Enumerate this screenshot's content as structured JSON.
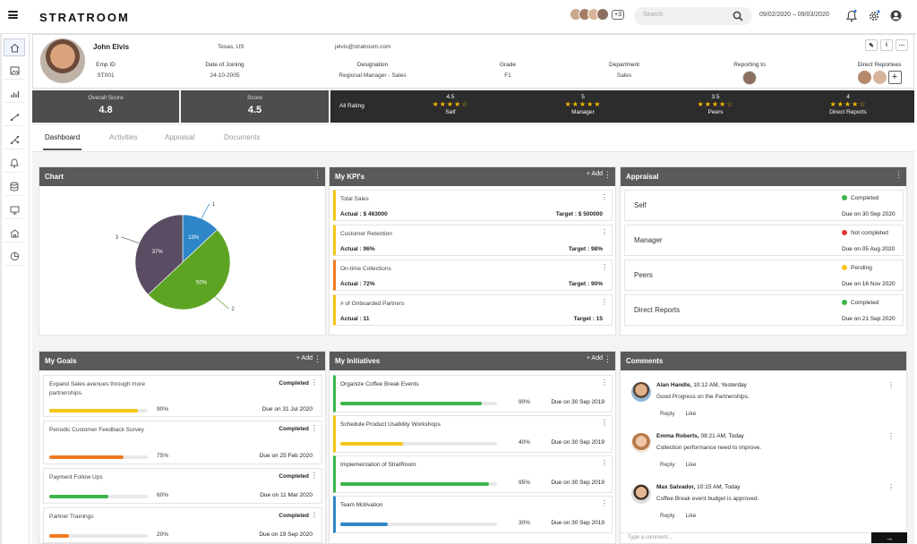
{
  "app": {
    "logo": "STRATROOM"
  },
  "header": {
    "participants_more": "+3",
    "search_placeholder": "Search",
    "date_range": "09/02/2020 – 09/03/2020"
  },
  "sidebar": {
    "icons": [
      "home-icon",
      "image-icon",
      "bar-chart-icon",
      "line-icon",
      "share-icon",
      "bell-icon",
      "database-icon",
      "monitor-icon",
      "building-icon",
      "pie-icon"
    ]
  },
  "profile": {
    "name": "John Elvis",
    "location": "Texas, US",
    "email": "jelvis@stratroom.com",
    "fields": [
      {
        "label": "Emp ID",
        "value": "ST001"
      },
      {
        "label": "Date of Joining",
        "value": "24-10-2005"
      },
      {
        "label": "Designation",
        "value": "Regional Manager - Sales"
      },
      {
        "label": "Grade",
        "value": "F1"
      },
      {
        "label": "Department",
        "value": "Sales"
      }
    ],
    "reporting_to_label": "Reporting to",
    "direct_reportees_label": "Direct Reportees"
  },
  "scores": {
    "overall_label": "Overall Score",
    "overall_value": "4.8",
    "score_label": "Score",
    "score_value": "4.5",
    "rating_label": "All Rating",
    "ratings": [
      {
        "value": "4.5",
        "stars": "★★★★☆",
        "name": "Self"
      },
      {
        "value": "5",
        "stars": "★★★★★",
        "name": "Manager"
      },
      {
        "value": "3.5",
        "stars": "★★★★☆",
        "name": "Peers"
      },
      {
        "value": "4",
        "stars": "★★★★☆",
        "name": "Direct Reports"
      }
    ]
  },
  "tabs": [
    "Dashboard",
    "Activities",
    "Appraisal",
    "Documents"
  ],
  "chart_panel": {
    "title": "Chart"
  },
  "chart_data": {
    "type": "pie",
    "slices": [
      {
        "label": "1",
        "value": 13,
        "text": "13%",
        "color": "#2e86c8"
      },
      {
        "label": "2",
        "value": 50,
        "text": "50%",
        "color": "#5da423"
      },
      {
        "label": "3",
        "value": 37,
        "text": "37%",
        "color": "#5a4c63"
      }
    ]
  },
  "kpis": {
    "title": "My KPI's",
    "add_label": "Add",
    "items": [
      {
        "name": "Total Sales",
        "actual": "Actual : $ 463000",
        "target": "Target : $ 500000",
        "color": "#f5c518"
      },
      {
        "name": "Customer Retention",
        "actual": "Actual : 96%",
        "target": "Target : 98%",
        "color": "#f5c518"
      },
      {
        "name": "On-time Collections",
        "actual": "Actual : 72%",
        "target": "Target : 90%",
        "color": "#f07a21"
      },
      {
        "name": "# of Onboarded Partners",
        "actual": "Actual : 11",
        "target": "Target : 15",
        "color": "#f5c518"
      }
    ]
  },
  "appraisal": {
    "title": "Appraisal",
    "items": [
      {
        "name": "Self",
        "status": "Completed",
        "color": "#3bb54a",
        "due": "Due on 30 Sep 2020"
      },
      {
        "name": "Manager",
        "status": "Not completed",
        "color": "#e53935",
        "due": "Due on 05 Aug 2020"
      },
      {
        "name": "Peers",
        "status": "Pending",
        "color": "#f5c518",
        "due": "Due on 16 Nov 2020"
      },
      {
        "name": "Direct Reports",
        "status": "Completed",
        "color": "#3bb54a",
        "due": "Due on 21 Sep 2020"
      }
    ]
  },
  "goals": {
    "title": "My Goals",
    "add_label": "Add",
    "items": [
      {
        "name": "Expand Sales avenues through more partnerships.",
        "status": "Completed",
        "progress": 0.9,
        "pct": "90%",
        "due": "Due on 31 Jul 2020",
        "color": "#f5c518"
      },
      {
        "name": "Periodic Customer Feedback Survey",
        "status": "Completed",
        "progress": 0.75,
        "pct": "75%",
        "due": "Due on 25 Feb 2020",
        "color": "#f07a21"
      },
      {
        "name": "Payment Follow Ups",
        "status": "Completed",
        "progress": 0.6,
        "pct": "60%",
        "due": "Due on 11 Mar 2020",
        "color": "#3bb54a"
      },
      {
        "name": "Partner Trainings",
        "status": "Completed",
        "progress": 0.2,
        "pct": "20%",
        "due": "Due on 19 Sep 2020",
        "color": "#f07a21"
      }
    ]
  },
  "initiatives": {
    "title": "My Initiatives",
    "add_label": "Add",
    "items": [
      {
        "name": "Organize Coffee Break Events",
        "progress": 0.9,
        "pct": "90%",
        "due": "Due on 30 Sep 2019",
        "color": "#3bb54a"
      },
      {
        "name": "Schedule Product Usability Workshops",
        "progress": 0.4,
        "pct": "40%",
        "due": "Due on 30 Sep 2019",
        "color": "#f5c518"
      },
      {
        "name": "Implementation of StratRoom",
        "progress": 0.95,
        "pct": "95%",
        "due": "Due on 30 Sep 2019",
        "color": "#3bb54a"
      },
      {
        "name": "Team Motivation",
        "progress": 0.3,
        "pct": "30%",
        "due": "Due on 30 Sep 2019",
        "color": "#2e86c8"
      }
    ]
  },
  "comments": {
    "title": "Comments",
    "reply_label": "Reply",
    "like_label": "Like",
    "input_placeholder": "Type a comment...",
    "items": [
      {
        "author": "Alan Handle,",
        "time": "10:12 AM, Yesterday",
        "text": "Good Progress on the Partnerships."
      },
      {
        "author": "Emma Roberts,",
        "time": "08:21 AM, Today",
        "text": "Collection performance need to improve."
      },
      {
        "author": "Max Salvador,",
        "time": "10:15 AM, Today",
        "text": "Coffee Break event budget is approved."
      }
    ]
  }
}
